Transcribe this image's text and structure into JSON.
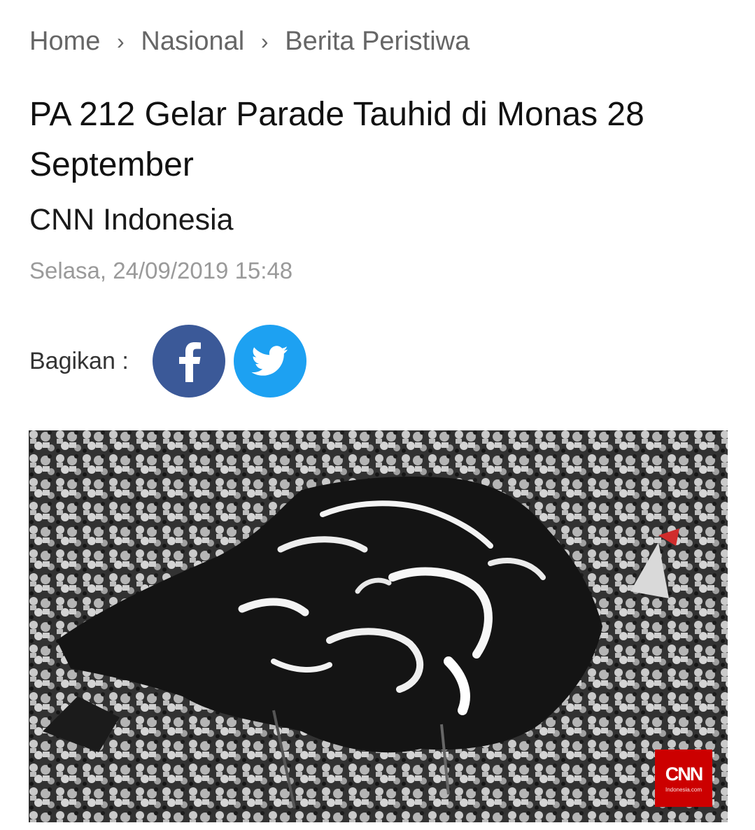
{
  "breadcrumb": {
    "items": [
      "Home",
      "Nasional",
      "Berita Peristiwa"
    ],
    "separator": "›"
  },
  "article": {
    "title": "PA 212 Gelar Parade Tauhid di Monas 28 September",
    "source": "CNN Indonesia",
    "date": "Selasa, 24/09/2019 15:48"
  },
  "share": {
    "label": "Bagikan :",
    "buttons": [
      {
        "name": "facebook",
        "icon": "facebook-icon",
        "color": "#3b5998"
      },
      {
        "name": "twitter",
        "icon": "twitter-icon",
        "color": "#1da1f2"
      }
    ]
  },
  "photo": {
    "watermark": {
      "logo": "CNN",
      "sub": "Indonesia.com",
      "color": "#cc0000"
    }
  }
}
